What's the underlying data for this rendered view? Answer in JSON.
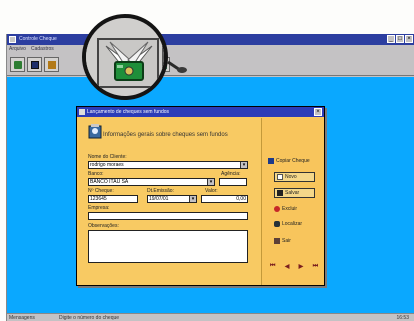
{
  "app": {
    "title": "Controle Cheque",
    "menu": [
      "Arquivo",
      "Cadastros"
    ],
    "window_buttons": [
      "_",
      "□",
      "×"
    ],
    "status_left": "Mensagens",
    "status_text": "Digite o número do cheque",
    "status_right": "16:53"
  },
  "toolbar_icons": [
    "connect-icon",
    "screen-icon",
    "books-icon",
    "winged-check-icon",
    "magnifier-icon",
    "exit-icon"
  ],
  "dialog": {
    "title": "Lançamento de cheques sem fundos",
    "info": "Informações gerais sobre cheques sem fundos",
    "fields": {
      "cliente_label": "Nome do Cliente:",
      "cliente_value": "rodrigo moraes",
      "banco_label": "Banco:",
      "banco_value": "BANCO ITAU SA",
      "agencia_label": "Agência:",
      "agencia_value": "",
      "cheque_label": "Nº Cheque:",
      "cheque_value": "123645",
      "emissao_label": "Dt.Emissão:",
      "emissao_value": "19/07/01",
      "valor_label": "Valor:",
      "valor_value": "0,00",
      "empresa_label": "Empresa:",
      "empresa_value": "",
      "obs_label": "Observações:",
      "obs_value": ""
    },
    "buttons": {
      "copiar": "Copiar Cheque",
      "novo": "Novo",
      "salvar": "Salvar",
      "excluir": "Excluir",
      "localizar": "Localizar",
      "sair": "Sair"
    },
    "nav": [
      "⏮",
      "◀",
      "▶",
      "⏭"
    ]
  },
  "colors": {
    "desktop": "#0aa8ff",
    "dialog_bg": "#f8ca63",
    "title_bar": "#2c3cb8",
    "zoom_ring": "#141414"
  }
}
